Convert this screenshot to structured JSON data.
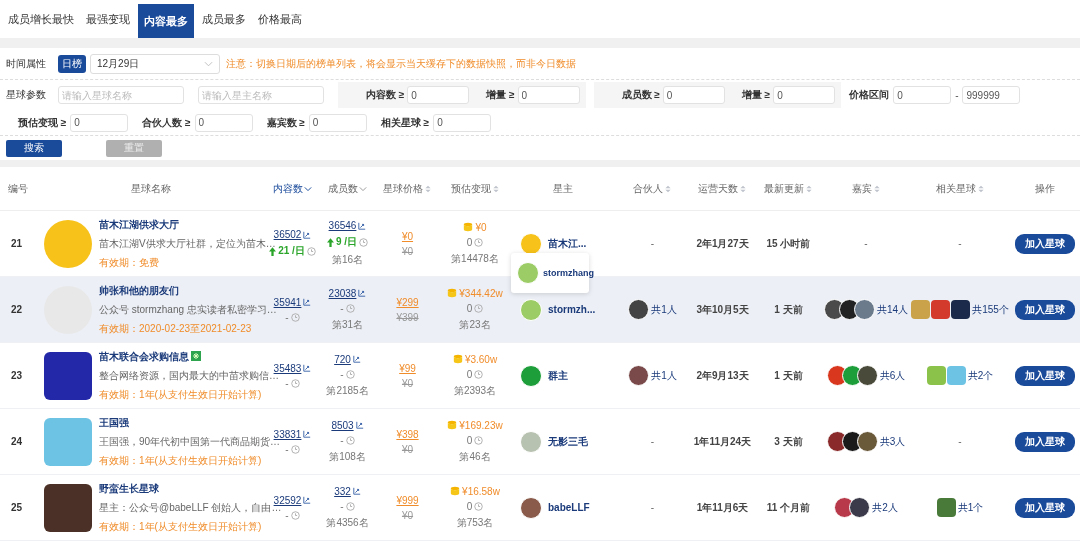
{
  "tabs": [
    {
      "label": "成员增长最快",
      "selected": false
    },
    {
      "label": "最强变现",
      "selected": false
    },
    {
      "label": "内容最多",
      "selected": true
    },
    {
      "label": "成员最多",
      "selected": false
    },
    {
      "label": "价格最高",
      "selected": false
    }
  ],
  "filters": {
    "time_label": "时间属性",
    "period_button": "日榜",
    "date": "12月29日",
    "notice": "注意：切换日期后的榜单列表，将会显示当天缓存下的数据快照，而非今日数据",
    "params_label": "星球参数",
    "name_fields": [
      {
        "placeholder": "请输入星球名称"
      },
      {
        "placeholder": "请输入星主名称"
      }
    ],
    "range_groups": [
      {
        "fields": [
          {
            "label": "内容数 ≥",
            "value": "0"
          },
          {
            "label": "增量 ≥",
            "value": "0"
          }
        ]
      },
      {
        "fields": [
          {
            "label": "成员数 ≥",
            "value": "0"
          },
          {
            "label": "增量 ≥",
            "value": "0"
          }
        ]
      }
    ],
    "price": {
      "label": "价格区间",
      "min": "0",
      "separator": "-",
      "max": "999999"
    },
    "more_fields": [
      {
        "label": "预估变现 ≥",
        "value": "0"
      },
      {
        "label": "合伙人数 ≥",
        "value": "0"
      },
      {
        "label": "嘉宾数 ≥",
        "value": "0"
      },
      {
        "label": "相关星球 ≥",
        "value": "0"
      }
    ],
    "search_button": "搜索",
    "reset_button": "重置"
  },
  "columns": [
    {
      "label": "编号",
      "kind": "plain"
    },
    {
      "label": "星球名称",
      "kind": "plain"
    },
    {
      "label": "内容数",
      "kind": "active"
    },
    {
      "label": "成员数",
      "kind": "descending"
    },
    {
      "label": "星球价格",
      "kind": "sortable"
    },
    {
      "label": "预估变现",
      "kind": "sortable"
    },
    {
      "label": "星主",
      "kind": "plain"
    },
    {
      "label": "合伙人",
      "kind": "sortable"
    },
    {
      "label": "运营天数",
      "kind": "sortable"
    },
    {
      "label": "最新更新",
      "kind": "sortable"
    },
    {
      "label": "嘉宾",
      "kind": "sortable"
    },
    {
      "label": "相关星球",
      "kind": "sortable"
    },
    {
      "label": "操作",
      "kind": "plain"
    }
  ],
  "rows": [
    {
      "number": "21",
      "hovered": false,
      "logo": {
        "kind": "round",
        "color": "#f7c21a"
      },
      "name": "苗木江湖供求大厅",
      "verified": false,
      "desc": "苗木江湖V供求大厅社群，定位为苗木…",
      "validity_label": "有效期：",
      "validity": "免费",
      "content": {
        "count": "36502",
        "growth": "21 /日",
        "rising": true
      },
      "members": {
        "count": "36546",
        "growth": "9 /日",
        "rising": true,
        "rank": "第16名"
      },
      "price": {
        "current": "¥0",
        "original": "¥0"
      },
      "estimate": {
        "value": "¥0",
        "count": "0",
        "rank": "第14478名"
      },
      "owner": {
        "name": "苗木江...",
        "color": "#f7c21a"
      },
      "partners": {
        "text": "-"
      },
      "days": "2年1月27天",
      "updated": "15 小时前",
      "guests": {
        "text": "-"
      },
      "related": {
        "text": "-"
      },
      "action": "加入星球"
    },
    {
      "number": "22",
      "hovered": true,
      "logo": {
        "kind": "round",
        "color": "#e8e8e8"
      },
      "name": "帅张和他的朋友们",
      "verified": false,
      "desc": "公众号 stormzhang 忠实读者私密学习…",
      "validity_label": "有效期：",
      "validity": "2020-02-23至2021-02-23",
      "content": {
        "count": "35941",
        "growth": "-",
        "rising": false
      },
      "members": {
        "count": "23038",
        "growth": "-",
        "rising": false,
        "rank": "第31名"
      },
      "price": {
        "current": "¥299",
        "original": "¥399"
      },
      "estimate": {
        "value": "¥344.42w",
        "count": "0",
        "rank": "第23名"
      },
      "owner": {
        "name": "stormzh...",
        "color": "#9ccc65"
      },
      "partners": {
        "text": "共1人",
        "avatars": [
          {
            "color": "#444444"
          }
        ]
      },
      "days": "3年10月5天",
      "updated": "1 天前",
      "guests": {
        "text": "共14人",
        "avatars": [
          {
            "color": "#4a4a4a"
          },
          {
            "color": "#222222"
          },
          {
            "color": "#6b7b8c"
          }
        ]
      },
      "related": {
        "text": "共155个",
        "avatars": [
          {
            "color": "#c9a24a"
          },
          {
            "color": "#d33a2c"
          },
          {
            "color": "#1b2a4a"
          }
        ]
      },
      "action": "加入星球"
    },
    {
      "number": "23",
      "hovered": false,
      "logo": {
        "kind": "square",
        "color": "#2228a8"
      },
      "name": "苗木联合会求购信息",
      "verified": true,
      "desc": "整合网络资源，国内最大的中苗求购信…",
      "validity_label": "有效期：",
      "validity": "1年(从支付生效日开始计算)",
      "content": {
        "count": "35483",
        "growth": "-",
        "rising": false
      },
      "members": {
        "count": "720",
        "growth": "-",
        "rising": false,
        "rank": "第2185名"
      },
      "price": {
        "current": "¥99",
        "original": "¥0"
      },
      "estimate": {
        "value": "¥3.60w",
        "count": "0",
        "rank": "第2393名"
      },
      "owner": {
        "name": "群主",
        "color": "#1e9e3a"
      },
      "partners": {
        "text": "共1人",
        "avatars": [
          {
            "color": "#7a4a4a"
          }
        ]
      },
      "days": "2年9月13天",
      "updated": "1 天前",
      "guests": {
        "text": "共6人",
        "avatars": [
          {
            "color": "#d9381e"
          },
          {
            "color": "#1e9e3a"
          },
          {
            "color": "#4a4a3a"
          }
        ]
      },
      "related": {
        "text": "共2个",
        "avatars": [
          {
            "color": "#8bc34a"
          },
          {
            "color": "#6cc3e3"
          }
        ]
      },
      "action": "加入星球"
    },
    {
      "number": "24",
      "hovered": false,
      "logo": {
        "kind": "square",
        "color": "#6cc3e3"
      },
      "name": "王国强",
      "verified": false,
      "desc": "王国强，90年代初中国第一代商品期货…",
      "validity_label": "有效期：",
      "validity": "1年(从支付生效日开始计算)",
      "content": {
        "count": "33831",
        "growth": "-",
        "rising": false
      },
      "members": {
        "count": "8503",
        "growth": "-",
        "rising": false,
        "rank": "第108名"
      },
      "price": {
        "current": "¥398",
        "original": "¥0"
      },
      "estimate": {
        "value": "¥169.23w",
        "count": "0",
        "rank": "第46名"
      },
      "owner": {
        "name": "无影三毛",
        "color": "#b8c2b0"
      },
      "partners": {
        "text": "-"
      },
      "days": "1年11月24天",
      "updated": "3 天前",
      "guests": {
        "text": "共3人",
        "avatars": [
          {
            "color": "#8a2a2a"
          },
          {
            "color": "#1a1a1a"
          },
          {
            "color": "#6a5a3a"
          }
        ]
      },
      "related": {
        "text": "-"
      },
      "action": "加入星球"
    },
    {
      "number": "25",
      "hovered": false,
      "logo": {
        "kind": "square",
        "color": "#4a3026"
      },
      "name": "野蛮生长星球",
      "verified": false,
      "desc": "星主：公众号@babeLLF 创始人，自由…",
      "validity_label": "有效期：",
      "validity": "1年(从支付生效日开始计算)",
      "content": {
        "count": "32592",
        "growth": "-",
        "rising": false
      },
      "members": {
        "count": "332",
        "growth": "-",
        "rising": false,
        "rank": "第4356名"
      },
      "price": {
        "current": "¥999",
        "original": "¥0"
      },
      "estimate": {
        "value": "¥16.58w",
        "count": "0",
        "rank": "第753名"
      },
      "owner": {
        "name": "babeLLF",
        "color": "#8a5a4a"
      },
      "partners": {
        "text": "-"
      },
      "days": "1年11月6天",
      "updated": "11 个月前",
      "guests": {
        "text": "共2人",
        "avatars": [
          {
            "color": "#b83a4a"
          },
          {
            "color": "#3a3a4a"
          }
        ]
      },
      "related": {
        "text": "共1个",
        "avatars": [
          {
            "color": "#4a7a3a"
          }
        ]
      },
      "action": "加入星球"
    }
  ],
  "tooltip": {
    "name": "stormzhang",
    "color": "#9ccc65"
  }
}
